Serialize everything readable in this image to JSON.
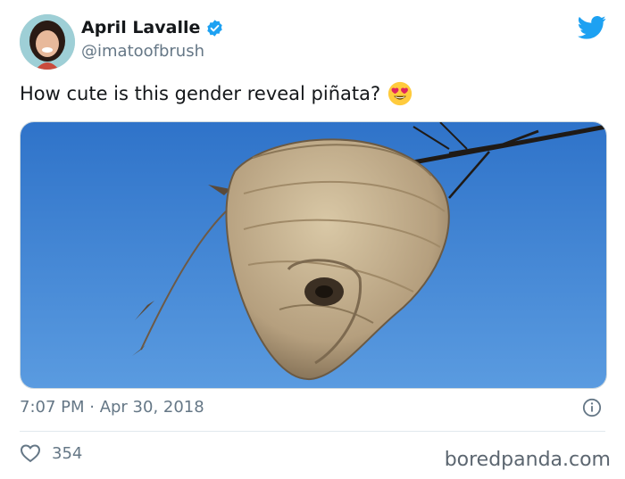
{
  "author": {
    "display_name": "April Lavalle",
    "handle": "@imatoofbrush",
    "verified": true,
    "avatar_icon": "profile-photo"
  },
  "tweet": {
    "text": "How cute is this gender reveal piñata?",
    "emoji": "heart-eyes-emoji",
    "media_description_icon": "wasp-nest-photo"
  },
  "meta": {
    "timestamp": "7:07 PM · Apr 30, 2018"
  },
  "actions": {
    "like_count": "354"
  },
  "watermark": "boredpanda.com",
  "colors": {
    "brand_blue": "#1da1f2",
    "secondary_text": "#657786",
    "sky": "#3a7fd0"
  }
}
